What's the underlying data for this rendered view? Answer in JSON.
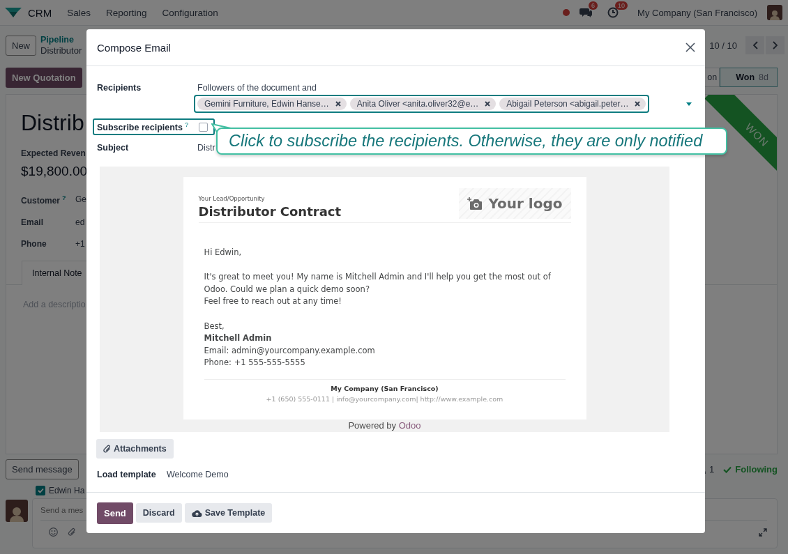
{
  "navbar": {
    "app": "CRM",
    "menus": [
      "Sales",
      "Reporting",
      "Configuration"
    ],
    "messages_badge": "6",
    "activities_badge": "10",
    "company": "My Company (San Francisco)"
  },
  "control_panel": {
    "new_button": "New",
    "breadcrumb": "Pipeline",
    "record": "Distributor",
    "pager": "10 / 10"
  },
  "statusbar": {
    "quotation_button": "New Quotation",
    "stages": [
      {
        "label": "on",
        "selected": false
      },
      {
        "label": "Won",
        "duration": "8d",
        "selected": true
      }
    ]
  },
  "record": {
    "title": "Distrib",
    "revenue_label": "Expected Reven",
    "revenue": "$19,800.00",
    "fields": [
      {
        "label": "Customer",
        "help": "?",
        "value": "Ge"
      },
      {
        "label": "Email",
        "value": "ed"
      },
      {
        "label": "Phone",
        "value": "+1"
      }
    ],
    "tabs": [
      {
        "label": "Internal Note",
        "selected": true
      }
    ],
    "description_placeholder": "Add a descriptio",
    "ribbon": "WON"
  },
  "chatter": {
    "send_button": "Send message",
    "followers_count": "1",
    "following": "Following",
    "recipient": {
      "label": "Edwin Ha",
      "checked": true
    },
    "composer_placeholder": "Send a mes"
  },
  "dialog": {
    "title": "Compose Email",
    "recipients": {
      "label": "Recipients",
      "intro": "Followers of the document and",
      "tags": [
        "Gemini Furniture, Edwin Hanse…",
        "Anita Oliver <anita.oliver32@e…",
        "Abigail Peterson <abigail.peter…"
      ]
    },
    "subscribe": {
      "label": "Subscribe recipients",
      "help": "?",
      "checked": false
    },
    "subject": {
      "label": "Subject",
      "value": "Distr"
    },
    "email": {
      "kicker": "Your Lead/Opportunity",
      "heading": "Distributor Contract",
      "logo": "Your logo",
      "greeting": "Hi Edwin,",
      "lines": [
        "It's great to meet you! My name is Mitchell Admin and I'll help you get the most out of Odoo. Could we plan a quick demo soon?",
        "Feel free to reach out at any time!"
      ],
      "closing": "Best,",
      "signature_name": "Mitchell Admin",
      "signature_email": "Email: admin@yourcompany.example.com",
      "signature_phone": "Phone: +1 555-555-5555",
      "footer_company": "My Company (San Francisco)",
      "footer_contact": "+1 (650) 555-0111 | info@yourcompany.com| http://www.example.com",
      "powered_by": "Powered by",
      "powered_brand": "Odoo"
    },
    "attachments_button": "Attachments",
    "template": {
      "label": "Load template",
      "value": "Welcome Demo"
    },
    "buttons": [
      {
        "label": "Send",
        "kind": "primary"
      },
      {
        "label": "Discard",
        "kind": "secondary"
      },
      {
        "label": "Save Template",
        "kind": "upload"
      }
    ]
  },
  "tooltip": "Click to subscribe the recipients. Otherwise, they are only notified"
}
